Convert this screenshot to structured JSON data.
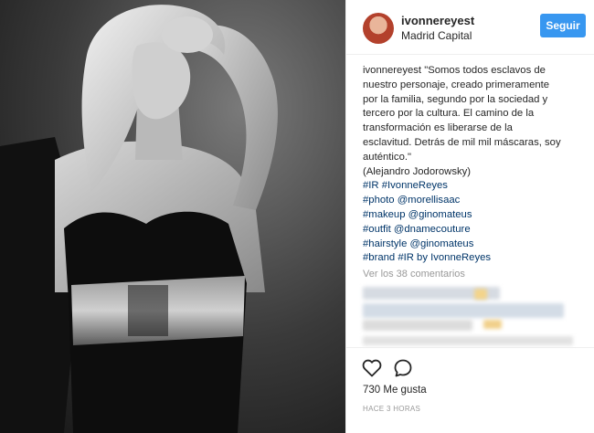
{
  "post": {
    "username": "ivonnereyest",
    "location": "Madrid Capital",
    "follow_label": "Seguir",
    "caption_lines": [
      {
        "text": "ivonnereyest \"Somos todos esclavos de",
        "tag": false
      },
      {
        "text": "nuestro personaje, creado primeramente",
        "tag": false
      },
      {
        "text": "por la familia, segundo por la sociedad y",
        "tag": false
      },
      {
        "text": "tercero por la cultura. El camino de la",
        "tag": false
      },
      {
        "text": "transformación es liberarse de la",
        "tag": false
      },
      {
        "text": "esclavitud. Detrás de mil mil máscaras, soy",
        "tag": false
      },
      {
        "text": "auténtico.\"",
        "tag": false
      },
      {
        "text": "(Alejandro Jodorowsky)",
        "tag": false
      },
      {
        "text": "#IR #IvonneReyes",
        "tag": true
      },
      {
        "text": "#photo @morellisaac",
        "tag": true
      },
      {
        "text": "#makeup @ginomateus",
        "tag": true
      },
      {
        "text": "#outfit @dnamecouture",
        "tag": true
      },
      {
        "text": "#hairstyle @ginomateus",
        "tag": true
      },
      {
        "text": "#brand #IR by IvonneReyes",
        "tag": true
      }
    ],
    "view_comments": "Ver los 38 comentarios",
    "likes": "730 Me gusta",
    "time": "HACE 3 HORAS",
    "icons": {
      "like": "heart-outline-icon",
      "comment": "comment-bubble-icon"
    },
    "colors": {
      "accent": "#3897f0",
      "hashtag": "#003569",
      "muted": "#999999",
      "text": "#262626"
    }
  }
}
